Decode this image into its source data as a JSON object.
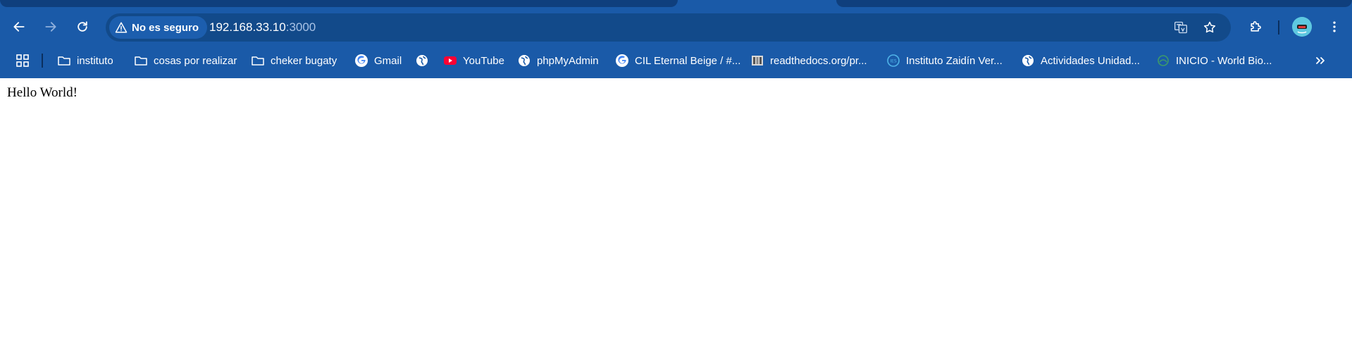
{
  "toolbar": {
    "back": "back-arrow-icon",
    "forward": "forward-arrow-icon",
    "reload": "reload-icon",
    "security_label": "No es seguro",
    "url_host": "192.168.33.10",
    "url_port": ":3000"
  },
  "bookmarks": [
    {
      "icon": "folder-icon",
      "label": "instituto"
    },
    {
      "icon": "folder-icon",
      "label": "cosas por realizar"
    },
    {
      "icon": "folder-icon",
      "label": "cheker bugaty"
    },
    {
      "icon": "google-icon",
      "label": "Gmail"
    },
    {
      "icon": "globe-icon",
      "label": ""
    },
    {
      "icon": "youtube-icon",
      "label": "YouTube"
    },
    {
      "icon": "globe-icon",
      "label": "phpMyAdmin"
    },
    {
      "icon": "google-icon",
      "label": "CIL Eternal Beige / #..."
    },
    {
      "icon": "docs-icon",
      "label": "readthedocs.org/pr..."
    },
    {
      "icon": "school-logo-icon",
      "label": "Instituto Zaidín Ver..."
    },
    {
      "icon": "globe-icon",
      "label": "Actividades Unidad..."
    },
    {
      "icon": "world-bio-icon",
      "label": "INICIO - World Bio..."
    }
  ],
  "page": {
    "text": "Hello World!"
  },
  "colors": {
    "chrome": "#1a5aa8",
    "omnibox": "#124a8a",
    "security_chip": "#1c5eae"
  }
}
